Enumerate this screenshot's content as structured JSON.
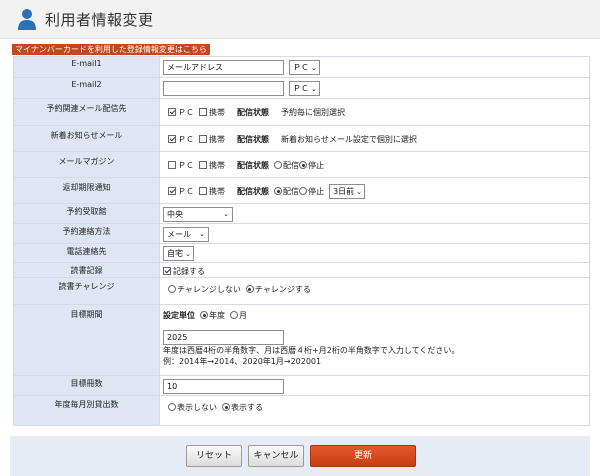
{
  "header": {
    "title": "利用者情報変更",
    "icon": "user-icon"
  },
  "mynumber_link": "マイナンバーカードを利用した登録情報変更はこちら",
  "form": {
    "email1": {
      "label": "E-mail1",
      "value": "メールアドレス",
      "device": "ＰＣ"
    },
    "email2": {
      "label": "E-mail2",
      "value": "",
      "device": "ＰＣ"
    },
    "reserve_mail": {
      "label": "予約関連メール配信先",
      "pc_label": "ＰＣ",
      "pc_checked": true,
      "mobile_label": "携帯",
      "mobile_checked": false,
      "status_label": "配信状態",
      "status_text": "予約毎に個別選択"
    },
    "news_mail": {
      "label": "新着お知らせメール",
      "pc_label": "ＰＣ",
      "pc_checked": true,
      "mobile_label": "携帯",
      "mobile_checked": false,
      "status_label": "配信状態",
      "status_text": "新着お知らせメール設定で個別に選択"
    },
    "magazine": {
      "label": "メールマガジン",
      "pc_label": "ＰＣ",
      "pc_checked": false,
      "mobile_label": "携帯",
      "mobile_checked": false,
      "status_label": "配信状態",
      "opt_send": "配信",
      "opt_stop": "停止",
      "selected": "停止"
    },
    "due_notice": {
      "label": "返却期限通知",
      "pc_label": "ＰＣ",
      "pc_checked": true,
      "mobile_label": "携帯",
      "mobile_checked": false,
      "status_label": "配信状態",
      "opt_send": "配信",
      "opt_stop": "停止",
      "selected": "配信",
      "days": "3日前"
    },
    "pickup_library": {
      "label": "予約受取館",
      "value": "中央"
    },
    "contact_method": {
      "label": "予約連絡方法",
      "value": "メール"
    },
    "phone_contact": {
      "label": "電話連絡先",
      "value": "自宅"
    },
    "reading_record": {
      "label": "読書記録",
      "checkbox_label": "記録する",
      "checked": true
    },
    "challenge": {
      "label": "読書チャレンジ",
      "opt_no": "チャレンジしない",
      "opt_yes": "チャレンジする",
      "selected": "チャレンジする"
    },
    "goal_period": {
      "label": "目標期間",
      "unit_label": "設定単位",
      "opt_year": "年度",
      "opt_month": "月",
      "selected": "年度",
      "value": "2025",
      "note1": "年度は西暦4桁の半角数字、月は西暦４桁+月2桁の半角数字で入力してください。",
      "note2": "例：2014年→2014、2020年1月→202001"
    },
    "goal_count": {
      "label": "目標冊数",
      "value": "10"
    },
    "monthly_show": {
      "label": "年度毎月別貸出数",
      "opt_hide": "表示しない",
      "opt_show": "表示する",
      "selected": "表示する"
    }
  },
  "buttons": {
    "reset": "リセット",
    "cancel": "キャンセル",
    "update": "更新"
  },
  "colors": {
    "label_bg": "#dde6f2",
    "accent": "#c4471f",
    "header_bg": "#f2f2f2",
    "footer_bg": "#e6ecf5"
  }
}
